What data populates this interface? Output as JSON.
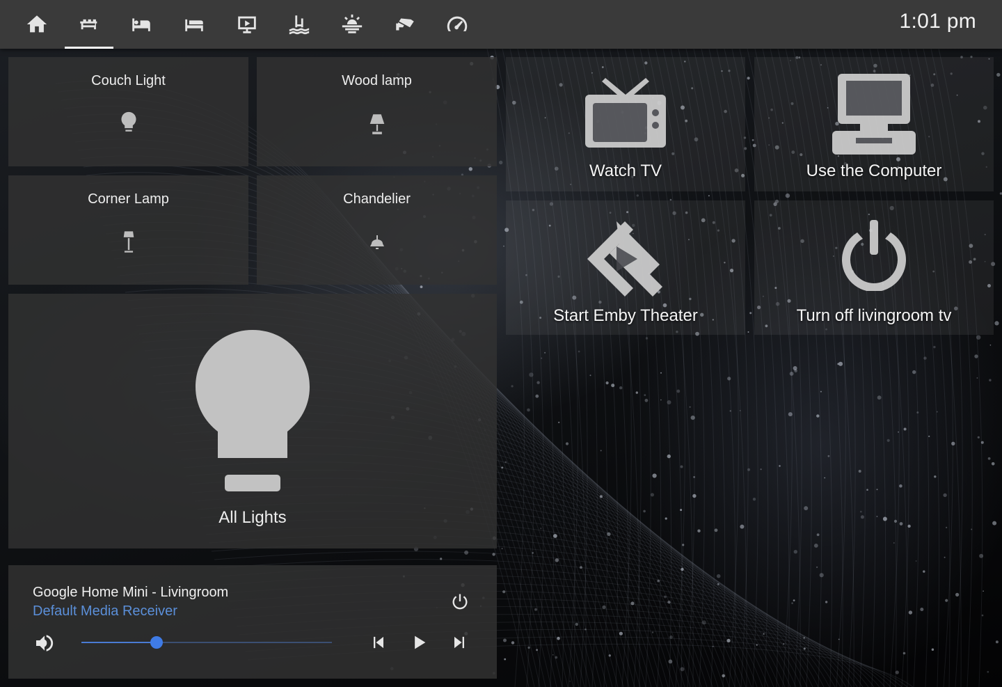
{
  "topbar": {
    "tabs": [
      {
        "icon": "home-icon",
        "active": false
      },
      {
        "icon": "sofa-icon",
        "active": true
      },
      {
        "icon": "bed-icon",
        "active": false
      },
      {
        "icon": "bed-single-icon",
        "active": false
      },
      {
        "icon": "theater-icon",
        "active": false
      },
      {
        "icon": "pool-icon",
        "active": false
      },
      {
        "icon": "weather-icon",
        "active": false
      },
      {
        "icon": "cctv-icon",
        "active": false
      },
      {
        "icon": "speedometer-icon",
        "active": false
      }
    ],
    "clock": "1:01 pm"
  },
  "lights": {
    "couch": {
      "label": "Couch Light",
      "icon": "bulb-icon"
    },
    "wood": {
      "label": "Wood lamp",
      "icon": "table-lamp-icon"
    },
    "corner": {
      "label": "Corner Lamp",
      "icon": "floor-lamp-icon"
    },
    "chandelier": {
      "label": "Chandelier",
      "icon": "ceiling-light-icon"
    },
    "all": {
      "label": "All Lights",
      "icon": "big-bulb-icon"
    }
  },
  "scenes": {
    "watch_tv": {
      "label": "Watch TV",
      "icon": "tv-icon"
    },
    "computer": {
      "label": "Use the Computer",
      "icon": "desktop-computer-icon"
    },
    "emby": {
      "label": "Start Emby Theater",
      "icon": "emby-icon"
    },
    "tv_off": {
      "label": "Turn off livingroom tv",
      "icon": "power-icon"
    }
  },
  "media_player": {
    "name": "Google Home Mini - Livingroom",
    "source": "Default Media Receiver",
    "volume": 0.3,
    "accent": "#3f7be6"
  }
}
